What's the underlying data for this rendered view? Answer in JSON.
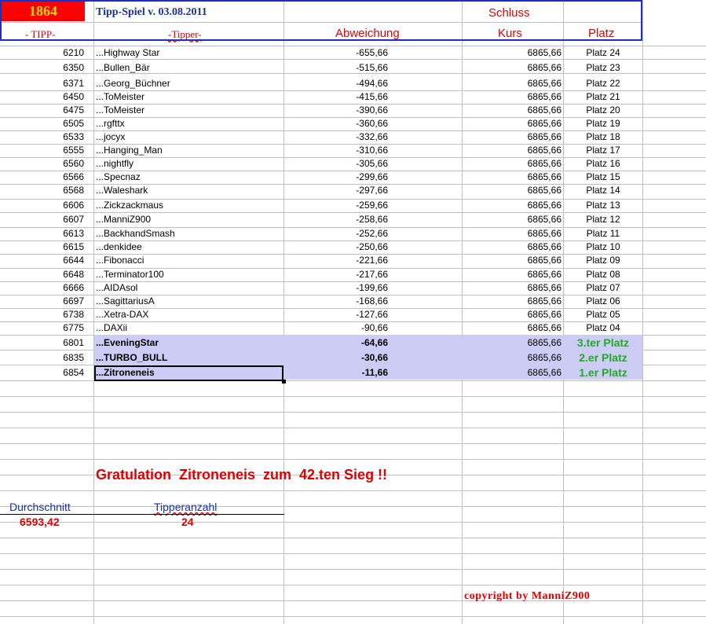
{
  "header": {
    "tipp_count": "1864",
    "title": "Tipp-Spiel v. 03.08.2011",
    "schluss": "Schluss",
    "col_tipp": "- TIPP-",
    "col_tipper": "-Tipper-",
    "col_abweichung": "Abweichung",
    "col_kurs": "Kurs",
    "col_platz": "Platz"
  },
  "rows": [
    {
      "tipp": "6210",
      "name": "...Highway Star",
      "abw": "-655,66",
      "kurs": "6865,66",
      "platz": "Platz 24"
    },
    {
      "tipp": "6350",
      "name": "...Bullen_Bär",
      "abw": "-515,66",
      "kurs": "6865,66",
      "platz": "Platz 23"
    },
    {
      "tipp": "6371",
      "name": "...Georg_Büchner",
      "abw": "-494,66",
      "kurs": "6865,66",
      "platz": "Platz 22"
    },
    {
      "tipp": "6450",
      "name": "...ToMeister",
      "abw": "-415,66",
      "kurs": "6865,66",
      "platz": "Platz 21"
    },
    {
      "tipp": "6475",
      "name": "...ToMeister",
      "abw": "-390,66",
      "kurs": "6865,66",
      "platz": "Platz 20"
    },
    {
      "tipp": "6505",
      "name": "...rgfttx",
      "abw": "-360,66",
      "kurs": "6865,66",
      "platz": "Platz 19"
    },
    {
      "tipp": "6533",
      "name": "...jocyx",
      "abw": "-332,66",
      "kurs": "6865,66",
      "platz": "Platz 18"
    },
    {
      "tipp": "6555",
      "name": "...Hanging_Man",
      "abw": "-310,66",
      "kurs": "6865,66",
      "platz": "Platz 17"
    },
    {
      "tipp": "6560",
      "name": "...nightfly",
      "abw": "-305,66",
      "kurs": "6865,66",
      "platz": "Platz 16"
    },
    {
      "tipp": "6566",
      "name": "...Specnaz",
      "abw": "-299,66",
      "kurs": "6865,66",
      "platz": "Platz 15"
    },
    {
      "tipp": "6568",
      "name": "...Waleshark",
      "abw": "-297,66",
      "kurs": "6865,66",
      "platz": "Platz 14"
    },
    {
      "tipp": "6606",
      "name": "...Zickzackmaus",
      "abw": "-259,66",
      "kurs": "6865,66",
      "platz": "Platz 13"
    },
    {
      "tipp": "6607",
      "name": "...ManniZ900",
      "abw": "-258,66",
      "kurs": "6865,66",
      "platz": "Platz 12"
    },
    {
      "tipp": "6613",
      "name": "...BackhandSmash",
      "abw": "-252,66",
      "kurs": "6865,66",
      "platz": "Platz 11"
    },
    {
      "tipp": "6615",
      "name": "...denkidee",
      "abw": "-250,66",
      "kurs": "6865,66",
      "platz": "Platz 10"
    },
    {
      "tipp": "6644",
      "name": "...Fibonacci",
      "abw": "-221,66",
      "kurs": "6865,66",
      "platz": "Platz 09"
    },
    {
      "tipp": "6648",
      "name": "...Terminator100",
      "abw": "-217,66",
      "kurs": "6865,66",
      "platz": "Platz 08"
    },
    {
      "tipp": "6666",
      "name": "...AIDAsol",
      "abw": "-199,66",
      "kurs": "6865,66",
      "platz": "Platz 07"
    },
    {
      "tipp": "6697",
      "name": "...SagittariusA",
      "abw": "-168,66",
      "kurs": "6865,66",
      "platz": "Platz 06"
    },
    {
      "tipp": "6738",
      "name": "...Xetra-DAX",
      "abw": "-127,66",
      "kurs": "6865,66",
      "platz": "Platz 05"
    },
    {
      "tipp": "6775",
      "name": "...DAXii",
      "abw": "-90,66",
      "kurs": "6865,66",
      "platz": "Platz 04"
    },
    {
      "tipp": "6801",
      "name": "...EveningStar",
      "abw": "-64,66",
      "kurs": "6865,66",
      "platz": "3.ter Platz"
    },
    {
      "tipp": "6835",
      "name": "...TURBO_BULL",
      "abw": "-30,66",
      "kurs": "6865,66",
      "platz": "2.er Platz"
    },
    {
      "tipp": "6854",
      "name": "...Zitroneneis",
      "abw": "-11,66",
      "kurs": "6865,66",
      "platz": "1.er Platz"
    }
  ],
  "gratulation": "Gratulation  Zitroneneis  zum  42.ten Sieg !!",
  "stats": {
    "durchschnitt_label": "Durchschnitt",
    "durchschnitt_value": "6593,42",
    "tipperanzahl_label": "Tipperanzahl",
    "tipperanzahl_value": "24"
  },
  "copyright": "copyright by ManniZ900",
  "colors": {
    "header_border": "#1f2fb8",
    "red": "#e00000",
    "green": "#22aa22",
    "highlight": "#ccccf4",
    "yellow": "#ffd700"
  }
}
